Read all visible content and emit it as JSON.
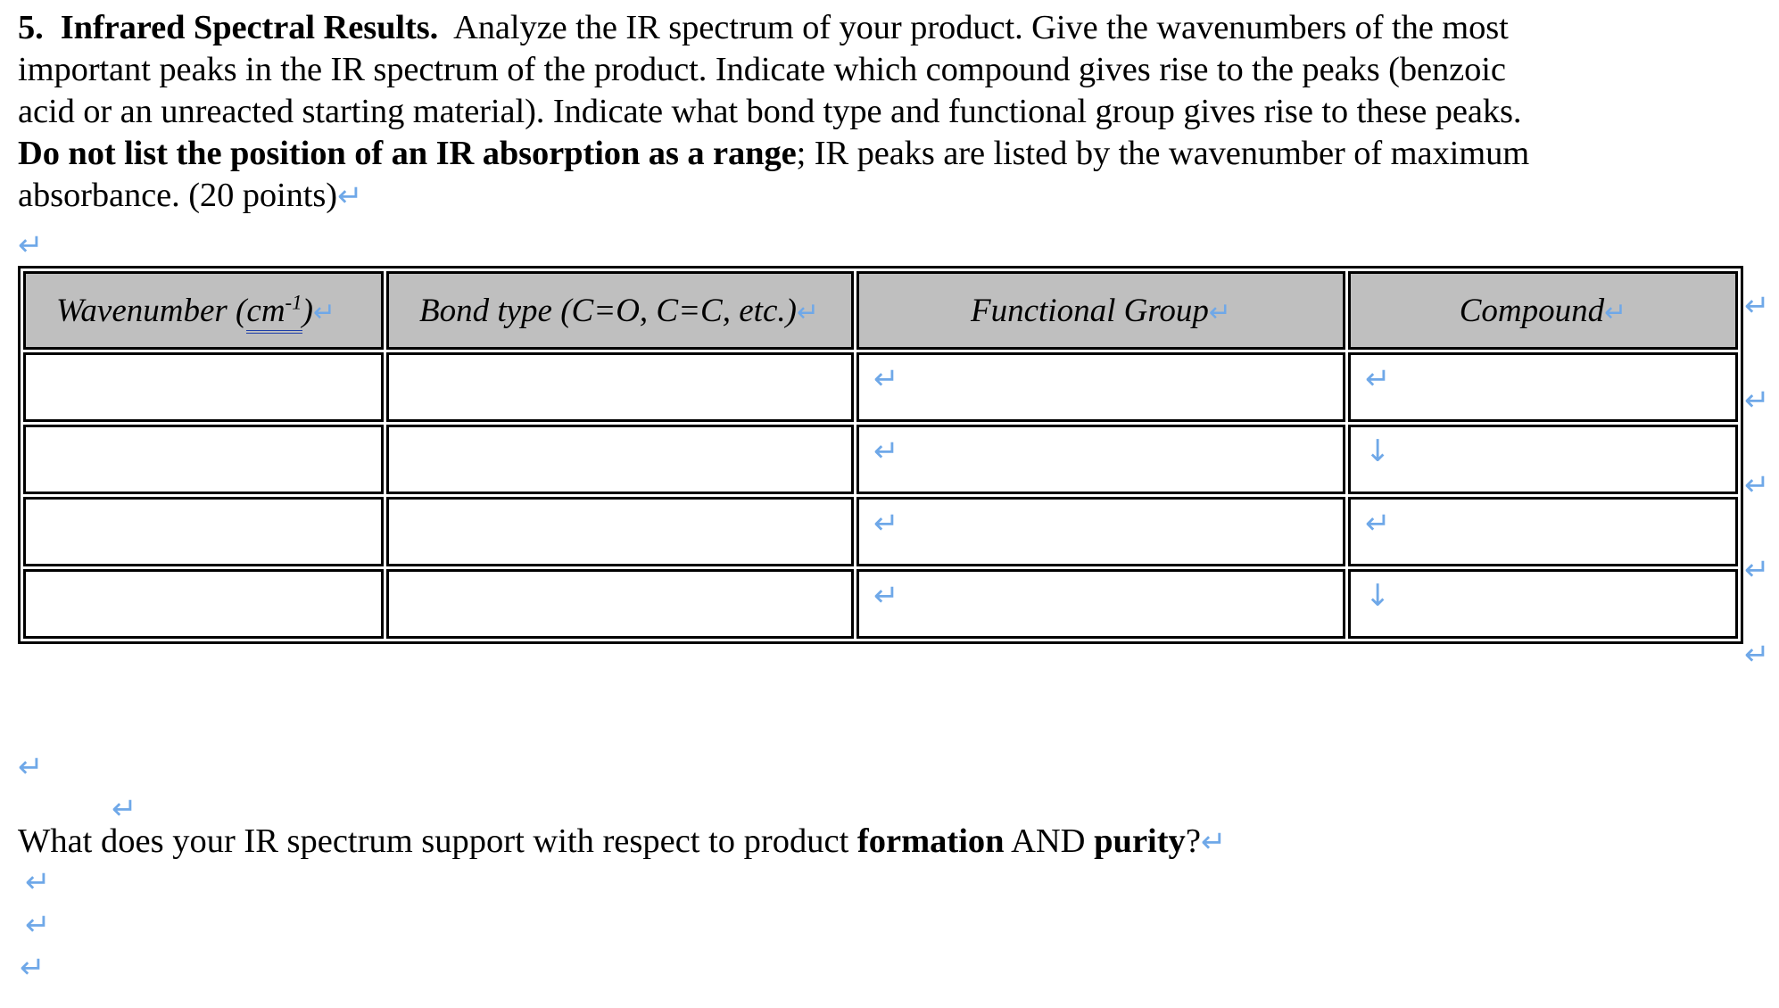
{
  "document": {
    "question_number": "5.",
    "question_title": "Infrared Spectral Results.",
    "intro_line1_rest": "Analyze the IR spectrum of your product.  Give the wavenumbers of the most",
    "intro_line2": "important peaks in the IR spectrum of the product.  Indicate which compound gives rise to the peaks (benzoic",
    "intro_line3": "acid or an unreacted starting material).  Indicate what bond type and functional group gives rise to these peaks.",
    "intro_line4_bold": "Do not list the position of an IR absorption as a range",
    "intro_line4_rest": "; IR peaks are listed by the wavenumber of maximum",
    "intro_line5": "absorbance. (20 points)"
  },
  "marks": {
    "return": "↵",
    "down": "↓"
  },
  "table": {
    "headers": [
      {
        "prefix": "Wavenumber (",
        "underlined": "cm",
        "superscript": "-1",
        "suffix": ")",
        "mark": "↵"
      },
      {
        "text": "Bond type (C=O, C=C, etc.)",
        "mark": "↵"
      },
      {
        "text": "Functional Group",
        "mark": "↵"
      },
      {
        "text": "Compound",
        "mark": "↵"
      }
    ],
    "header_row_outer_mark": "↵",
    "rows": [
      {
        "wavenumber": "",
        "bond_type": "",
        "functional_group_mark": "↵",
        "compound_mark": "↵",
        "outer_mark": "↵"
      },
      {
        "wavenumber": "",
        "bond_type": "",
        "functional_group_mark": "↵",
        "compound_mark": "↓",
        "outer_mark": "↵"
      },
      {
        "wavenumber": "",
        "bond_type": "",
        "functional_group_mark": "↵",
        "compound_mark": "↵",
        "outer_mark": "↵"
      },
      {
        "wavenumber": "",
        "bond_type": "",
        "functional_group_mark": "↵",
        "compound_mark": "↓",
        "outer_mark": "↵"
      }
    ]
  },
  "after_table": {
    "blank_mark_1": "↵",
    "blank_mark_2": "↵",
    "question_part1": "What does your IR spectrum support with respect to product ",
    "question_bold1": "formation",
    "question_part2": " AND ",
    "question_bold2": "purity",
    "question_part3": "?",
    "question_mark": "↵",
    "trailing_mark_1": "↵",
    "trailing_mark_2": "↵",
    "trailing_mark_3": "↵"
  },
  "colors": {
    "mark_blue": "#6FA8E8",
    "header_fill": "#BFBFBF",
    "underline_blue": "#1F3FA8",
    "border": "#000000"
  }
}
